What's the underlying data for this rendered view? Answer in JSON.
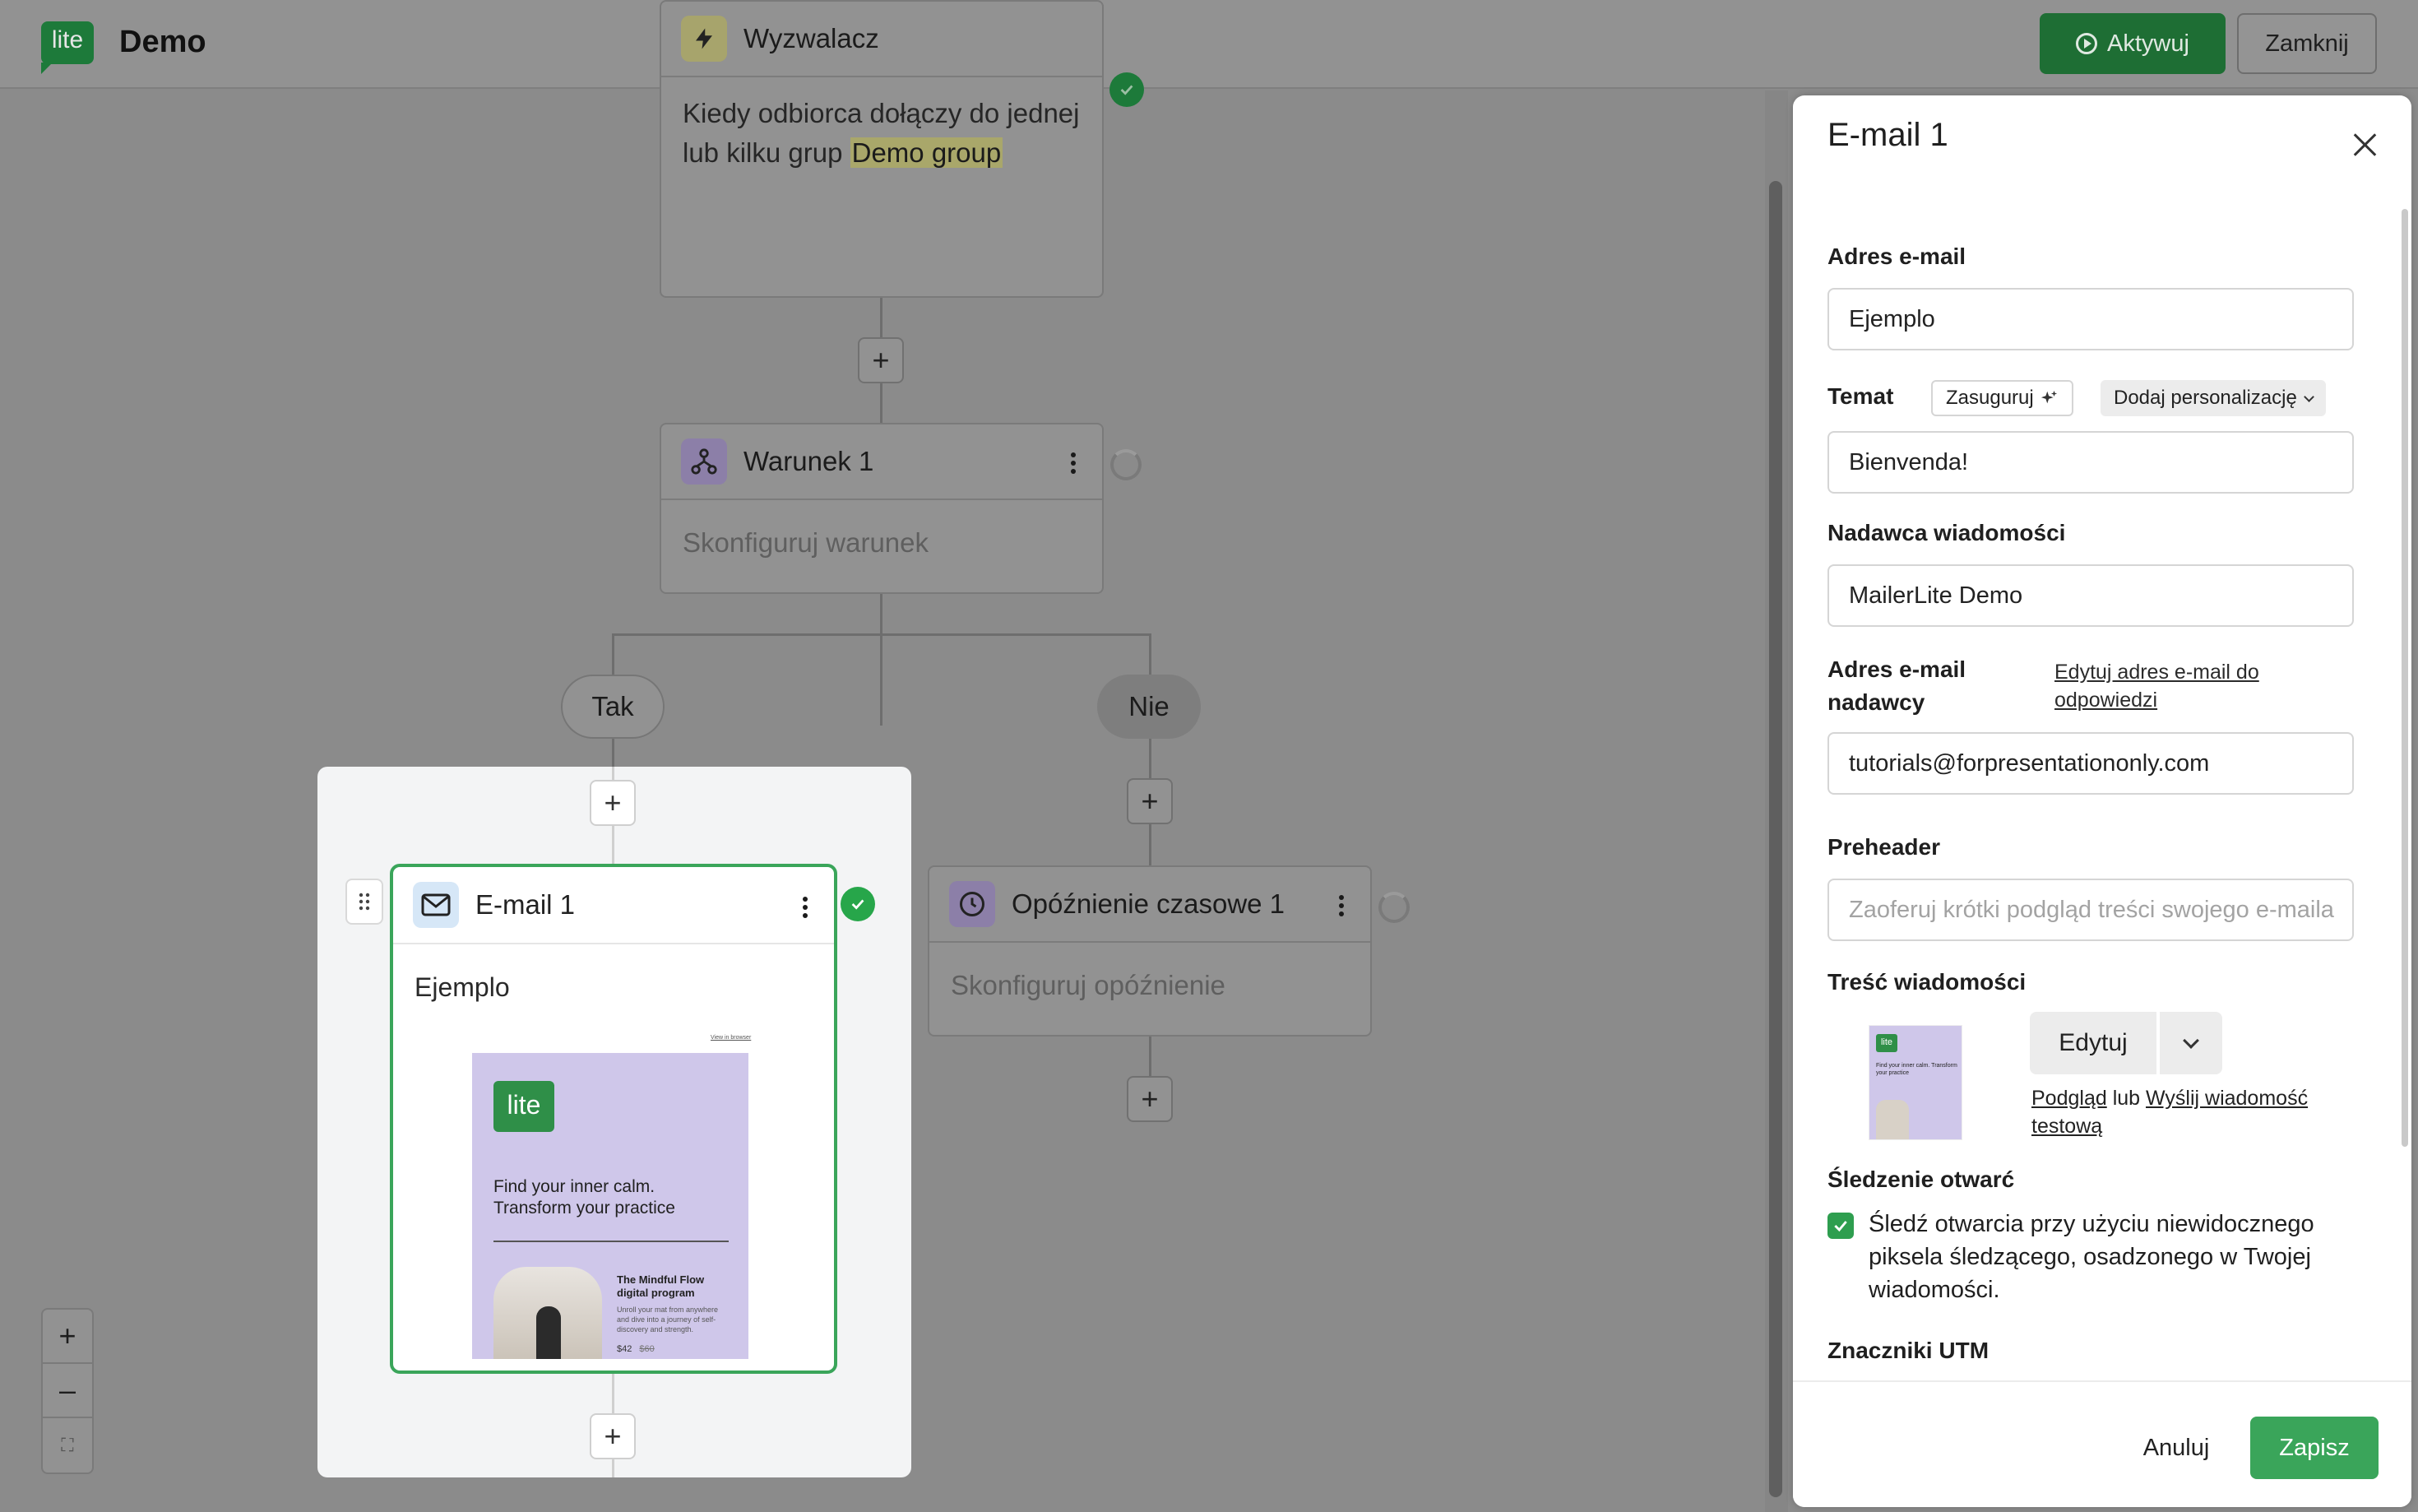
{
  "header": {
    "logo_text": "lite",
    "title": "Demo",
    "activate_label": "Aktywuj",
    "close_label": "Zamknij"
  },
  "workflow": {
    "trigger": {
      "title": "Wyzwalacz",
      "body_prefix": "Kiedy odbiorca dołączy do jednej lub kilku grup",
      "group": "Demo group"
    },
    "condition": {
      "title": "Warunek 1",
      "placeholder": "Skonfiguruj warunek"
    },
    "branch_yes": "Tak",
    "branch_no": "Nie",
    "email": {
      "title": "E-mail 1",
      "subject": "Ejemplo",
      "thumb": {
        "logo": "lite",
        "top_link": "View in browser",
        "headline_1": "Find your inner calm.",
        "headline_2": "Transform your practice",
        "product_1": "The Mindful Flow",
        "product_2": "digital program",
        "desc": "Unroll your mat from anywhere and dive into a journey of self-discovery and strength.",
        "price": "$42",
        "old_price": "$60"
      }
    },
    "delay": {
      "title": "Opóźnienie czasowe 1",
      "placeholder": "Skonfiguruj opóźnienie"
    },
    "plus": "+"
  },
  "zoom": {
    "in": "+",
    "out": "–",
    "fit": "⛶"
  },
  "panel": {
    "title": "E-mail 1",
    "email_label": "Adres e-mail",
    "email_value": "Ejemplo",
    "subject_label": "Temat",
    "suggest_label": "Zasuguruj",
    "personalize_label": "Dodaj personalizację",
    "subject_value": "Bienvenda!",
    "sender_label": "Nadawca wiadomości",
    "sender_value": "MailerLite Demo",
    "sender_email_label_1": "Adres e-mail",
    "sender_email_label_2": "nadawcy",
    "reply_link_1": "Edytuj adres e-mail do",
    "reply_link_2": "odpowiedzi",
    "sender_email_value": "tutorials@forpresentationonly.com",
    "preheader_label": "Preheader",
    "preheader_placeholder": "Zaoferuj krótki podgląd treści swojego e-maila",
    "content_label": "Treść wiadomości",
    "edit_label": "Edytuj",
    "preview_link": "Podgląd",
    "or_text": "lub",
    "test_link_1": "Wyślij wiadomość",
    "test_link_2": "testową",
    "tracking_label": "Śledzenie otwarć",
    "tracking_text": "Śledź otwarcia przy użyciu niewidocznego piksela śledzącego, osadzonego w Twojej wiadomości.",
    "utm_label": "Znaczniki UTM",
    "cancel_label": "Anuluj",
    "save_label": "Zapisz",
    "thumb_logo": "lite",
    "thumb_text": "Find your inner calm. Transform your practice"
  },
  "colors": {
    "accent": "#3aa55a",
    "accent_dark": "#1e6e34",
    "overlay": "#8b8b8b"
  }
}
